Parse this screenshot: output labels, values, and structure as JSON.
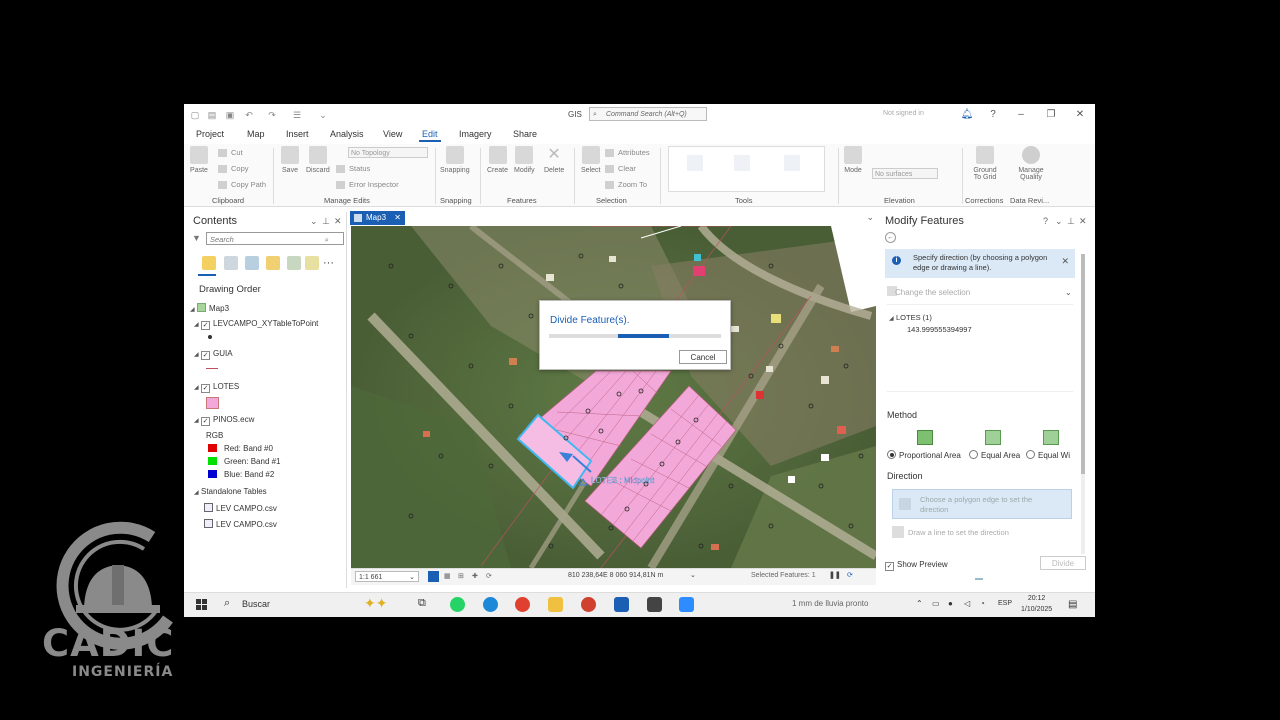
{
  "window": {
    "title": "GIS",
    "command_search_placeholder": "Command Search (Alt+Q)",
    "signin": "Not signed in"
  },
  "ribbon_tabs": [
    "Project",
    "Map",
    "Insert",
    "Analysis",
    "View",
    "Edit",
    "Imagery",
    "Share"
  ],
  "active_tab": "Edit",
  "ribbon": {
    "clipboard": {
      "label": "Clipboard",
      "paste": "Paste",
      "cut": "Cut",
      "copy": "Copy",
      "copy_path": "Copy Path"
    },
    "manage_edits": {
      "label": "Manage Edits",
      "save": "Save",
      "discard": "Discard",
      "topology": "No Topology",
      "status": "Status",
      "error_inspector": "Error Inspector"
    },
    "snapping": {
      "label": "Snapping",
      "snapping": "Snapping"
    },
    "features": {
      "label": "Features",
      "create": "Create",
      "modify": "Modify",
      "delete": "Delete"
    },
    "selection": {
      "label": "Selection",
      "select": "Select",
      "attributes": "Attributes",
      "clear": "Clear",
      "zoom_to": "Zoom To"
    },
    "tools": {
      "label": "Tools"
    },
    "elevation": {
      "label": "Elevation",
      "mode": "Mode",
      "surfaces": "No surfaces"
    },
    "corrections": {
      "label": "Corrections",
      "ground_to_grid": "Ground To Grid"
    },
    "data_review": {
      "label": "Data Revi...",
      "manage_quality": "Manage Quality"
    }
  },
  "contents": {
    "title": "Contents",
    "search_placeholder": "Search",
    "drawing_order": "Drawing Order",
    "map_name": "Map3",
    "layers": {
      "lev": "LEVCAMPO_XYTableToPoint",
      "guia": "GUIA",
      "lotes": "LOTES",
      "pinos": "PINOS.ecw",
      "rgb": "RGB",
      "red": "Red:",
      "red_band": "Band #0",
      "green": "Green:",
      "green_band": "Band #1",
      "blue": "Blue:",
      "blue_band": "Band #2",
      "standalone": "Standalone Tables",
      "table1": "LEV CAMPO.csv",
      "table2": "LEV CAMPO.csv"
    }
  },
  "map": {
    "tab": "Map3",
    "snap_label": "LOTES : Midpoint",
    "scale": "1:1 661",
    "coords": "810 238,64E 8 060 914,81N m",
    "selected": "Selected Features: 1"
  },
  "dialog": {
    "title": "Divide Feature(s).",
    "progress": 0.7,
    "cancel": "Cancel"
  },
  "modify": {
    "title": "Modify Features",
    "info": "Specify direction (by choosing a polygon edge or drawing a line).",
    "change_selection": "Change the selection",
    "selection_layer": "LOTES (1)",
    "selection_value": "143.999555394997",
    "method": "Method",
    "methods": [
      "Proportional Area",
      "Equal Area",
      "Equal Wi"
    ],
    "direction": "Direction",
    "direction_opt1": "Choose a polygon edge to set the direction",
    "direction_opt2": "Draw a line to set the direction",
    "show_preview": "Show Preview",
    "divide": "Divide"
  },
  "taskbar": {
    "search": "Buscar",
    "weather": "1 mm de lluvia pronto",
    "lang": "ESP",
    "time": "20:12",
    "date": "1/10/2025"
  },
  "watermark": {
    "brand": "CADIC",
    "sub": "INGENIERÍA"
  },
  "colors": {
    "accent": "#1a5fb4",
    "lotes_fill": "#f2a9d9",
    "selected_outline": "#3fb8f0"
  }
}
